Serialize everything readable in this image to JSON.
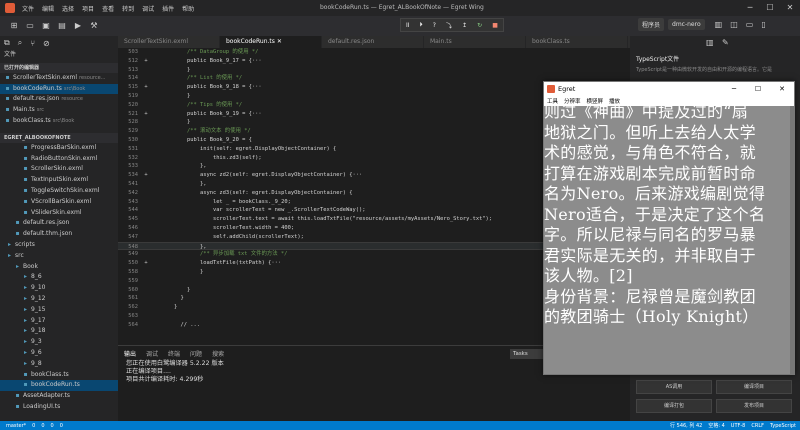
{
  "titlebar": {
    "menu": [
      "文件",
      "编辑",
      "选择",
      "项目",
      "查看",
      "转到",
      "调试",
      "插件",
      "帮助"
    ],
    "title": "bookCodeRun.ts — Egret_ALBookOfNote — Egret Wing",
    "account_mode": "程序员",
    "account_name": "dmc-nero"
  },
  "debug_toolbar": [
    "II",
    "⏵",
    "?",
    "⤵",
    "↥",
    "↻",
    "■"
  ],
  "sidebar": {
    "header": "文件",
    "open_editors_title": "已打开的编辑器",
    "open_editors": [
      {
        "name": "ScrollerTextSkin.exml",
        "hint": "resource..."
      },
      {
        "name": "bookCodeRun.ts",
        "hint": "src\\Book"
      },
      {
        "name": "default.res.json",
        "hint": "resource"
      },
      {
        "name": "Main.ts",
        "hint": "src"
      },
      {
        "name": "bookClass.ts",
        "hint": "src\\Book"
      }
    ],
    "project_title": "EGRET_ALBOOKOFNOTE",
    "tree": [
      {
        "name": "ProgressBarSkin.exml",
        "indent": 2
      },
      {
        "name": "RadioButtonSkin.exml",
        "indent": 2
      },
      {
        "name": "ScrollerSkin.exml",
        "indent": 2
      },
      {
        "name": "TextInputSkin.exml",
        "indent": 2
      },
      {
        "name": "ToggleSwitchSkin.exml",
        "indent": 2
      },
      {
        "name": "VScrollBarSkin.exml",
        "indent": 2
      },
      {
        "name": "VSliderSkin.exml",
        "indent": 2
      },
      {
        "name": "default.res.json",
        "indent": 1
      },
      {
        "name": "default.thm.json",
        "indent": 1
      },
      {
        "name": "scripts",
        "indent": 0
      },
      {
        "name": "src",
        "indent": 0
      },
      {
        "name": "Book",
        "indent": 1
      },
      {
        "name": "8_6",
        "indent": 2
      },
      {
        "name": "9_10",
        "indent": 2
      },
      {
        "name": "9_12",
        "indent": 2
      },
      {
        "name": "9_15",
        "indent": 2
      },
      {
        "name": "9_17",
        "indent": 2
      },
      {
        "name": "9_18",
        "indent": 2
      },
      {
        "name": "9_3",
        "indent": 2
      },
      {
        "name": "9_6",
        "indent": 2
      },
      {
        "name": "9_8",
        "indent": 2
      },
      {
        "name": "bookClass.ts",
        "indent": 2
      },
      {
        "name": "bookCodeRun.ts",
        "indent": 2
      },
      {
        "name": "AssetAdapter.ts",
        "indent": 1
      },
      {
        "name": "LoadingUI.ts",
        "indent": 1
      }
    ]
  },
  "tabs": [
    "ScrollerTextSkin.exml",
    "bookCodeRun.ts",
    "default.res.json",
    "Main.ts",
    "bookClass.ts"
  ],
  "editor_lines": [
    {
      "n": "503",
      "fold": "",
      "code": "    /** DataGroup 的使用 */"
    },
    {
      "n": "512",
      "fold": "+",
      "code": "    public Book_9_17 = {···"
    },
    {
      "n": "513",
      "fold": "",
      "code": "    }"
    },
    {
      "n": "514",
      "fold": "",
      "code": "    /** List 的使用 */"
    },
    {
      "n": "515",
      "fold": "+",
      "code": "    public Book_9_18 = {···"
    },
    {
      "n": "519",
      "fold": "",
      "code": "    }"
    },
    {
      "n": "520",
      "fold": "",
      "code": "    /** Tips 的使用 */"
    },
    {
      "n": "521",
      "fold": "+",
      "code": "    public Book_9_19 = {···"
    },
    {
      "n": "528",
      "fold": "",
      "code": "    }"
    },
    {
      "n": "529",
      "fold": "",
      "code": "    /** 滚动文本 的使用 */"
    },
    {
      "n": "530",
      "fold": "",
      "code": "    public Book_9_20 = {"
    },
    {
      "n": "531",
      "fold": "",
      "code": "        init(self: egret.DisplayObjectContainer) {"
    },
    {
      "n": "532",
      "fold": "",
      "code": "            this.zd3(self);"
    },
    {
      "n": "533",
      "fold": "",
      "code": "        },"
    },
    {
      "n": "534",
      "fold": "+",
      "code": "        async zd2(self: egret.DisplayObjectContainer) {···"
    },
    {
      "n": "541",
      "fold": "",
      "code": "        },"
    },
    {
      "n": "542",
      "fold": "",
      "code": "        async zd3(self: egret.DisplayObjectContainer) {"
    },
    {
      "n": "543",
      "fold": "",
      "code": "            let _ = bookClass._9_20;"
    },
    {
      "n": "544",
      "fold": "",
      "code": "            var scrollerText = new _.ScrollerTextCodeWay();"
    },
    {
      "n": "545",
      "fold": "",
      "code": "            scrollerText.text = await this.loadTxtFile(\"resource/assets/myAssets/Nero_Story.txt\");"
    },
    {
      "n": "546",
      "fold": "",
      "code": "            scrollerText.width = 400;"
    },
    {
      "n": "547",
      "fold": "",
      "code": "            self.addChild(scrollerText);"
    },
    {
      "n": "548",
      "fold": "",
      "code": "        },"
    },
    {
      "n": "549",
      "fold": "",
      "code": "        /** 异步加载 txt 文件的方法 */"
    },
    {
      "n": "550",
      "fold": "+",
      "code": "        loadTxtFile(txtPath) {···"
    },
    {
      "n": "558",
      "fold": "",
      "code": "        }"
    },
    {
      "n": "559",
      "fold": "",
      "code": ""
    },
    {
      "n": "560",
      "fold": "",
      "code": "    }"
    },
    {
      "n": "561",
      "fold": "",
      "code": "  }"
    },
    {
      "n": "562",
      "fold": "",
      "code": "}"
    },
    {
      "n": "563",
      "fold": "",
      "code": ""
    },
    {
      "n": "564",
      "fold": "",
      "code": "  // ..."
    },
    {
      "n": "",
      "fold": "",
      "code": ""
    }
  ],
  "panel": {
    "tabs": [
      "输出",
      "调试",
      "终端",
      "问题",
      "搜索"
    ],
    "task_select": "Tasks",
    "output": [
      "您正在使用白鹭编译器 5.2.22 版本",
      "正在编译项目....",
      "项目共计编译耗时: 4.299秒"
    ]
  },
  "right_panel": {
    "title": "TypeScript文件",
    "desc": "TypeScript是一种由微软开发的自由和开源的编程语言。它是",
    "buttons": [
      "AS调用",
      "编译项目",
      "编译打包",
      "发布项目"
    ]
  },
  "statusbar": {
    "left": [
      "master*",
      "0",
      "0",
      "0",
      "0"
    ],
    "right": [
      "行 546, 列 42",
      "空格: 4",
      "UTF-8",
      "CRLF",
      "TypeScript"
    ]
  },
  "popup": {
    "title": "Egret",
    "menu": [
      "工具",
      "分辨率",
      "横竖屏",
      "播放"
    ],
    "story_lines": [
      "则过《神曲》中提及过的“扇",
      "地狱之门。但听上去给人太学",
      "术的感觉，与角色不符合，就",
      "打算在游戏剧本完成前暂时命",
      "名为Nero。后来游戏编剧觉得",
      "Nero适合，于是决定了这个名",
      "字。所以尼禄与同名的罗马暴",
      "君实际是无关的，并非取自于",
      "该人物。[2]",
      "身份背景：尼禄曾是魔剑教团",
      "的教团骑士（Holy Knight）"
    ]
  }
}
